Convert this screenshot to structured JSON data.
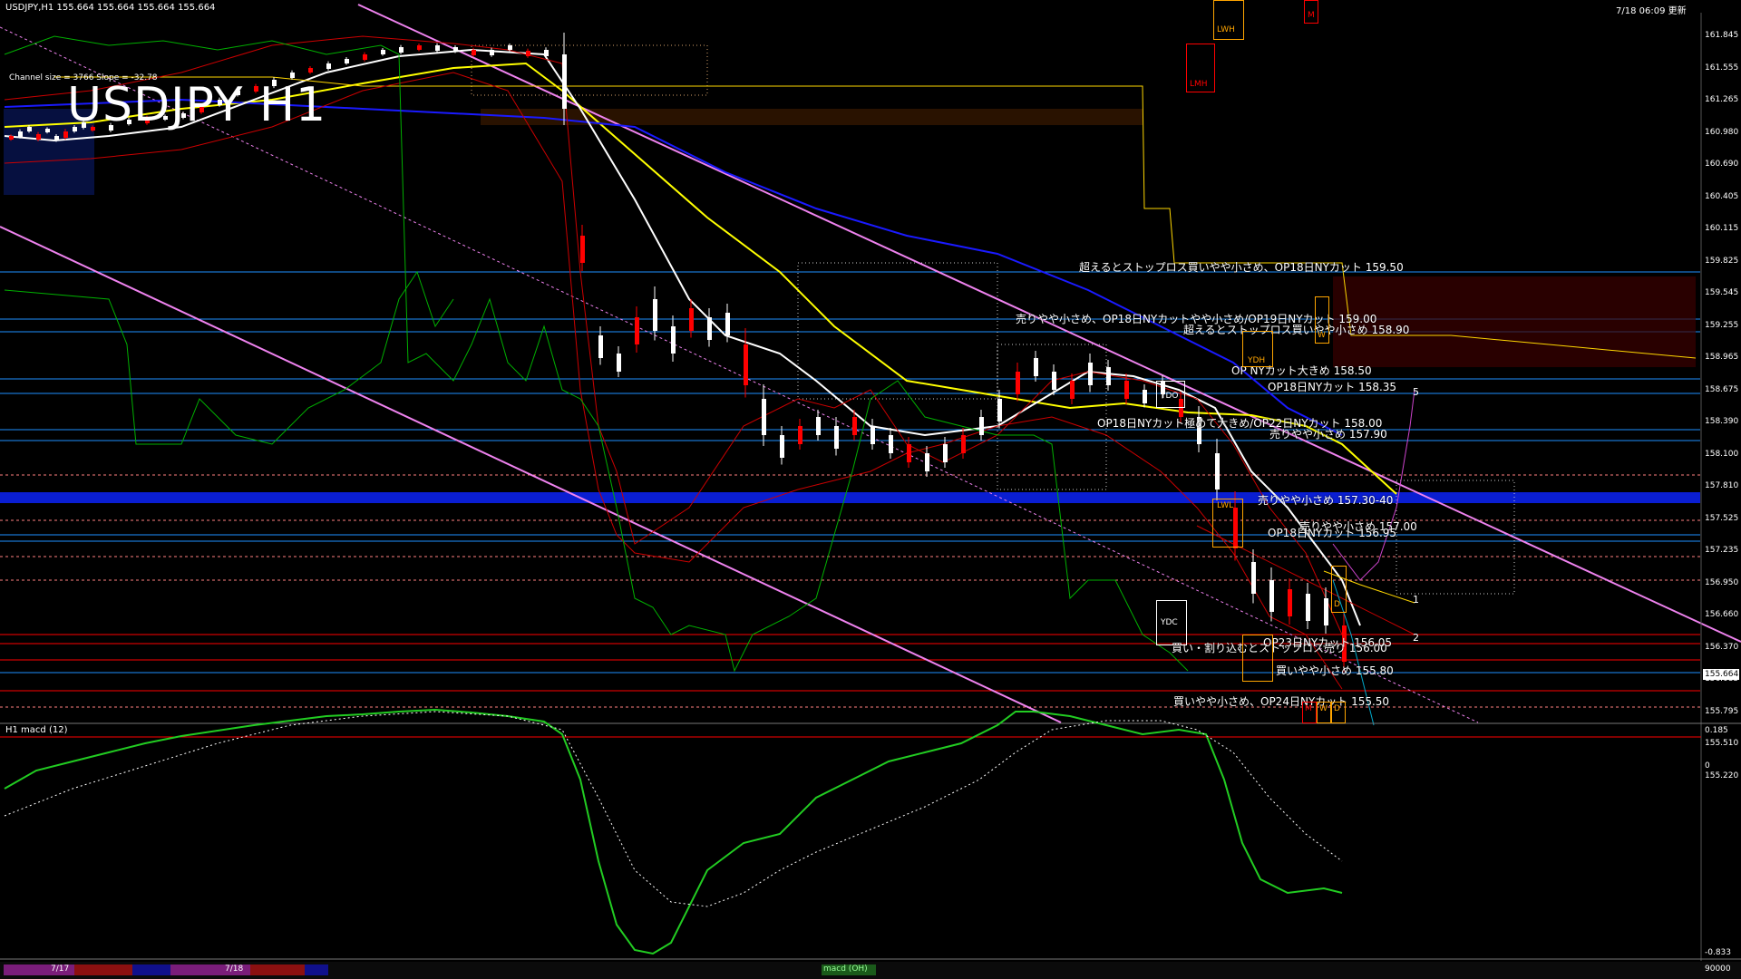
{
  "header": {
    "symbol_info": "USDJPY,H1   155.664 155.664 155.664 155.664",
    "datetime": "7/18 06:09 更新"
  },
  "chart_title": "USDJPY H1",
  "channel_info": "Channel size = 3766  Slope = -32.78",
  "price_axis": {
    "labels": [
      "161.845",
      "161.555",
      "161.265",
      "160.980",
      "160.690",
      "160.405",
      "160.115",
      "159.825",
      "159.545",
      "159.255",
      "158.965",
      "158.675",
      "158.390",
      "158.100",
      "157.810",
      "157.525",
      "157.235",
      "156.950",
      "156.660",
      "156.370",
      "156.085",
      "155.795",
      "155.510",
      "155.220"
    ],
    "current_price": "155.664"
  },
  "annotations": [
    "超えるとストップロス買いやや小さめ、OP18日NYカット 159.50",
    "売りやや小さめ、OP18日NYカットやや小さめ/OP19日NYカット 159.00",
    "超えるとストップロス買いやや小さめ 158.90",
    "OP     NYカット大きめ 158.50",
    "OP18日NYカット 158.35",
    "OP18日NYカット極めて大きめ/OP22日NYカット 158.00",
    "売りやや小さめ 157.90",
    "売りやや小さめ 157.30-40",
    "売りやや小さめ 157.00",
    "OP18日NYカット 156.95",
    "買い・割り込むとストップロス売り 156.00",
    "OP23日NYカット 156.05",
    "買いやや小さめ 155.80",
    "買いやや小さめ、OP24日NYカット 155.50"
  ],
  "line_numbers": [
    "1",
    "2",
    "5"
  ],
  "markers": {
    "lwh": "LWH",
    "lwl": "LWL",
    "lmh": "LMH",
    "ydh": "YDH",
    "ydo": "YDO",
    "ydc": "YDC",
    "ydl": "YDL",
    "m": "M",
    "w": "W",
    "d": "D"
  },
  "macd": {
    "label": "H1  macd (12)",
    "axis_top": "0.185",
    "axis_zero": "0",
    "axis_bottom": "-0.833"
  },
  "status_bar": {
    "dates": [
      "7/17",
      "7/18"
    ],
    "indicator_tab": "macd (OH)",
    "right_value": "90000"
  },
  "colors": {
    "background": "#000000",
    "candle_up": "#ffffff",
    "candle_down": "#ff0000",
    "trend_line": "#ee82ee",
    "ma_yellow": "#ffff00",
    "ma_blue": "#0000ff",
    "ma_white": "#ffffff",
    "green_line": "#00c000",
    "macd_signal": "#ffb6c1"
  }
}
